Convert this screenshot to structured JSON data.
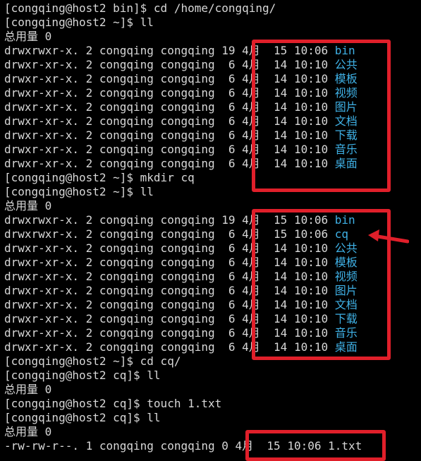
{
  "terminal": {
    "lines": [
      {
        "type": "cmd",
        "text": "[congqing@host2 bin]$ cd /home/congqing/"
      },
      {
        "type": "cmd",
        "text": "[congqing@host2 ~]$ ll"
      },
      {
        "type": "text",
        "text": "总用量 0"
      },
      {
        "type": "entry",
        "meta": "drwxrwxr-x. 2 congqing congqing 19 4月  15 10:06 ",
        "name": "bin",
        "kind": "dir"
      },
      {
        "type": "entry",
        "meta": "drwxr-xr-x. 2 congqing congqing  6 4月  14 10:10 ",
        "name": "公共",
        "kind": "dir"
      },
      {
        "type": "entry",
        "meta": "drwxr-xr-x. 2 congqing congqing  6 4月  14 10:10 ",
        "name": "模板",
        "kind": "dir"
      },
      {
        "type": "entry",
        "meta": "drwxr-xr-x. 2 congqing congqing  6 4月  14 10:10 ",
        "name": "视频",
        "kind": "dir"
      },
      {
        "type": "entry",
        "meta": "drwxr-xr-x. 2 congqing congqing  6 4月  14 10:10 ",
        "name": "图片",
        "kind": "dir"
      },
      {
        "type": "entry",
        "meta": "drwxr-xr-x. 2 congqing congqing  6 4月  14 10:10 ",
        "name": "文档",
        "kind": "dir"
      },
      {
        "type": "entry",
        "meta": "drwxr-xr-x. 2 congqing congqing  6 4月  14 10:10 ",
        "name": "下载",
        "kind": "dir"
      },
      {
        "type": "entry",
        "meta": "drwxr-xr-x. 2 congqing congqing  6 4月  14 10:10 ",
        "name": "音乐",
        "kind": "dir"
      },
      {
        "type": "entry",
        "meta": "drwxr-xr-x. 2 congqing congqing  6 4月  14 10:10 ",
        "name": "桌面",
        "kind": "dir"
      },
      {
        "type": "cmd",
        "text": "[congqing@host2 ~]$ mkdir cq"
      },
      {
        "type": "cmd",
        "text": "[congqing@host2 ~]$ ll"
      },
      {
        "type": "text",
        "text": "总用量 0"
      },
      {
        "type": "entry",
        "meta": "drwxrwxr-x. 2 congqing congqing 19 4月  15 10:06 ",
        "name": "bin",
        "kind": "dir"
      },
      {
        "type": "entry",
        "meta": "drwxrwxr-x. 2 congqing congqing  6 4月  15 10:06 ",
        "name": "cq",
        "kind": "dir"
      },
      {
        "type": "entry",
        "meta": "drwxr-xr-x. 2 congqing congqing  6 4月  14 10:10 ",
        "name": "公共",
        "kind": "dir"
      },
      {
        "type": "entry",
        "meta": "drwxr-xr-x. 2 congqing congqing  6 4月  14 10:10 ",
        "name": "模板",
        "kind": "dir"
      },
      {
        "type": "entry",
        "meta": "drwxr-xr-x. 2 congqing congqing  6 4月  14 10:10 ",
        "name": "视频",
        "kind": "dir"
      },
      {
        "type": "entry",
        "meta": "drwxr-xr-x. 2 congqing congqing  6 4月  14 10:10 ",
        "name": "图片",
        "kind": "dir"
      },
      {
        "type": "entry",
        "meta": "drwxr-xr-x. 2 congqing congqing  6 4月  14 10:10 ",
        "name": "文档",
        "kind": "dir"
      },
      {
        "type": "entry",
        "meta": "drwxr-xr-x. 2 congqing congqing  6 4月  14 10:10 ",
        "name": "下载",
        "kind": "dir"
      },
      {
        "type": "entry",
        "meta": "drwxr-xr-x. 2 congqing congqing  6 4月  14 10:10 ",
        "name": "音乐",
        "kind": "dir"
      },
      {
        "type": "entry",
        "meta": "drwxr-xr-x. 2 congqing congqing  6 4月  14 10:10 ",
        "name": "桌面",
        "kind": "dir"
      },
      {
        "type": "cmd",
        "text": "[congqing@host2 ~]$ cd cq/"
      },
      {
        "type": "cmd",
        "text": "[congqing@host2 cq]$ ll"
      },
      {
        "type": "text",
        "text": "总用量 0"
      },
      {
        "type": "cmd",
        "text": "[congqing@host2 cq]$ touch 1.txt"
      },
      {
        "type": "cmd",
        "text": "[congqing@host2 cq]$ ll"
      },
      {
        "type": "text",
        "text": "总用量 0"
      },
      {
        "type": "entry",
        "meta": "-rw-rw-r--. 1 congqing congqing 0 4月  15 10:06 ",
        "name": "1.txt",
        "kind": "file"
      }
    ]
  },
  "colors": {
    "background": "#000000",
    "text": "#d7d7d7",
    "directory": "#3fb1e6",
    "annotation": "#e01f2a"
  },
  "annotations": [
    "highlight-box-first-listing",
    "highlight-box-second-listing",
    "highlight-box-file-listing",
    "arrow-icon"
  ]
}
